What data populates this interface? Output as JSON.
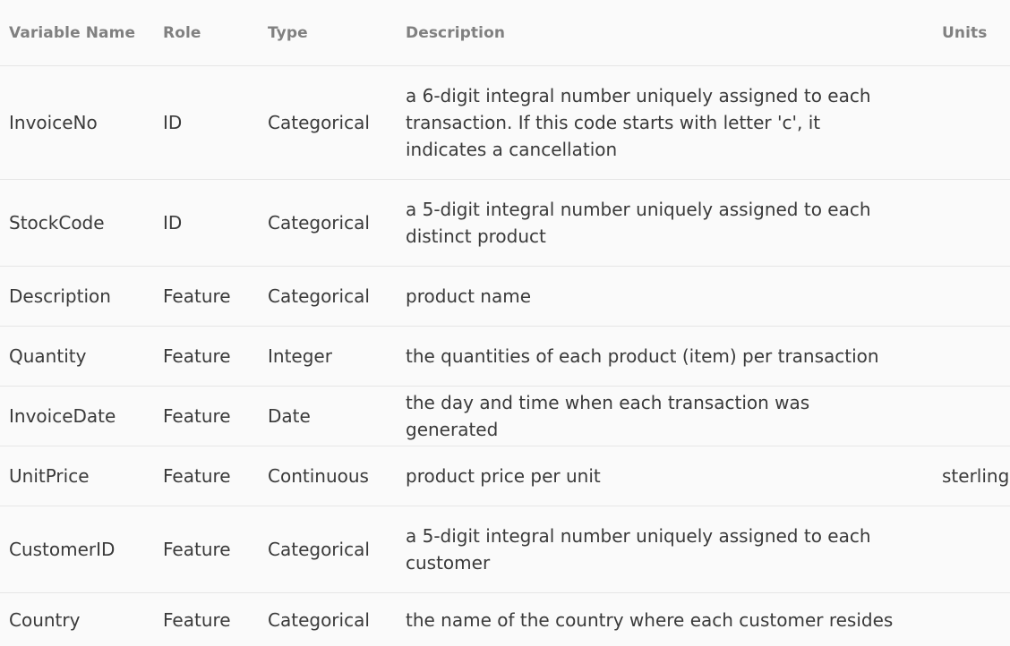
{
  "table": {
    "headers": {
      "name": "Variable Name",
      "role": "Role",
      "type": "Type",
      "description": "Description",
      "units": "Units"
    },
    "rows": [
      {
        "name": "InvoiceNo",
        "role": "ID",
        "type": "Categorical",
        "description": "a 6-digit integral number uniquely assigned to each transaction. If this code starts with letter 'c', it indicates a cancellation",
        "units": ""
      },
      {
        "name": "StockCode",
        "role": "ID",
        "type": "Categorical",
        "description": "a 5-digit integral number uniquely assigned to each distinct product",
        "units": ""
      },
      {
        "name": "Description",
        "role": "Feature",
        "type": "Categorical",
        "description": "product name",
        "units": ""
      },
      {
        "name": "Quantity",
        "role": "Feature",
        "type": "Integer",
        "description": "the quantities of each product (item) per transaction",
        "units": ""
      },
      {
        "name": "InvoiceDate",
        "role": "Feature",
        "type": "Date",
        "description": "the day and time when each transaction was generated",
        "units": ""
      },
      {
        "name": "UnitPrice",
        "role": "Feature",
        "type": "Continuous",
        "description": "product price per unit",
        "units": "sterling"
      },
      {
        "name": "CustomerID",
        "role": "Feature",
        "type": "Categorical",
        "description": "a 5-digit integral number uniquely assigned to each customer",
        "units": ""
      },
      {
        "name": "Country",
        "role": "Feature",
        "type": "Categorical",
        "description": "the name of the country where each customer resides",
        "units": ""
      }
    ]
  }
}
